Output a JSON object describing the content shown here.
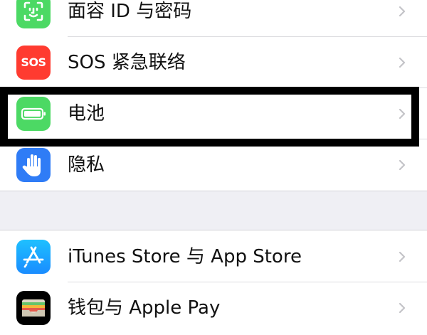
{
  "settings_group_1": {
    "items": [
      {
        "label": "面容 ID 与密码",
        "icon": "face-id-icon"
      },
      {
        "label": "SOS 紧急联络",
        "icon": "sos-icon",
        "icon_text": "SOS"
      },
      {
        "label": "电池",
        "icon": "battery-icon"
      },
      {
        "label": "隐私",
        "icon": "hand-icon"
      }
    ]
  },
  "settings_group_2": {
    "items": [
      {
        "label": "iTunes Store 与 App Store",
        "icon": "app-store-icon"
      },
      {
        "label": "钱包与 Apple Pay",
        "icon": "wallet-icon"
      }
    ]
  },
  "colors": {
    "face_id": "#4cd964",
    "sos": "#ff3b30",
    "battery": "#4cd964",
    "privacy": "#2f7cf6",
    "app_store": "#1a9bff",
    "wallet": "#000000",
    "highlight": "#000000"
  }
}
